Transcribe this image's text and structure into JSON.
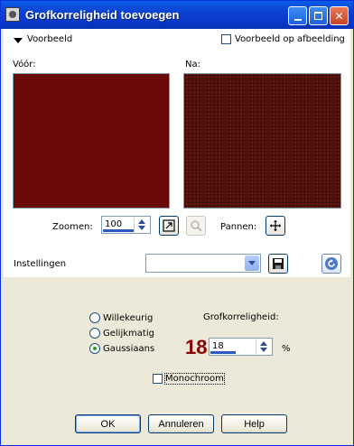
{
  "window": {
    "title": "Grofkorreligheid toevoegen"
  },
  "preview": {
    "header_label": "Voorbeeld",
    "on_image_label": "Voorbeeld op afbeelding",
    "before_label": "Vóór:",
    "after_label": "Na:",
    "zoom_label": "Zoomen:",
    "zoom_value": "100",
    "pan_label": "Pannen:"
  },
  "settings": {
    "label": "Instellingen",
    "preset_value": ""
  },
  "options": {
    "radios": [
      {
        "label": "Willekeurig",
        "checked": false
      },
      {
        "label": "Gelijkmatig",
        "checked": false
      },
      {
        "label": "Gaussiaans",
        "checked": true
      }
    ],
    "grain_label": "Grofkorreligheid:",
    "grain_big": "18",
    "grain_value": "18",
    "grain_unit": "%",
    "mono_label": "Monochroom"
  },
  "buttons": {
    "ok": "OK",
    "cancel": "Annuleren",
    "help": "Help"
  },
  "colors": {
    "before_fill": "#6a0a08",
    "after_fill": "#5d120c",
    "accent": "#8b0000"
  }
}
